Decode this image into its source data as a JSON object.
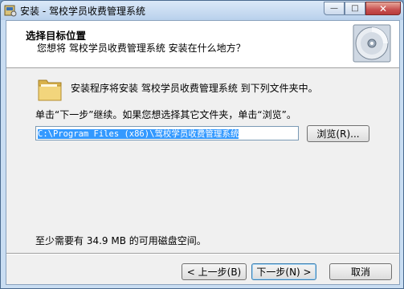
{
  "window": {
    "title": "安装 - 驾校学员收费管理系统",
    "controls": {
      "minimize": "—",
      "maximize": "□",
      "close": "✕"
    }
  },
  "header": {
    "title": "选择目标位置",
    "subtitle": "您想将 驾校学员收费管理系统 安装在什么地方？",
    "graphic": "disc-icon"
  },
  "body": {
    "folder_message": "安装程序将安装 驾校学员收费管理系统 到下列文件夹中。",
    "instruction": "单击“下一步”继续。如果您想选择其它文件夹，单击“浏览”。",
    "path_value": "C:\\Program Files (x86)\\驾校学员收费管理系统",
    "browse_label": "浏览(R)...",
    "space_required": "至少需要有 34.9 MB 的可用磁盘空间。"
  },
  "footer": {
    "back_label": "< 上一步(B)",
    "next_label": "下一步(N) >",
    "cancel_label": "取消"
  },
  "colors": {
    "selection": "#3399ff",
    "frame": "#c9ddf2",
    "close": "#c75050"
  }
}
